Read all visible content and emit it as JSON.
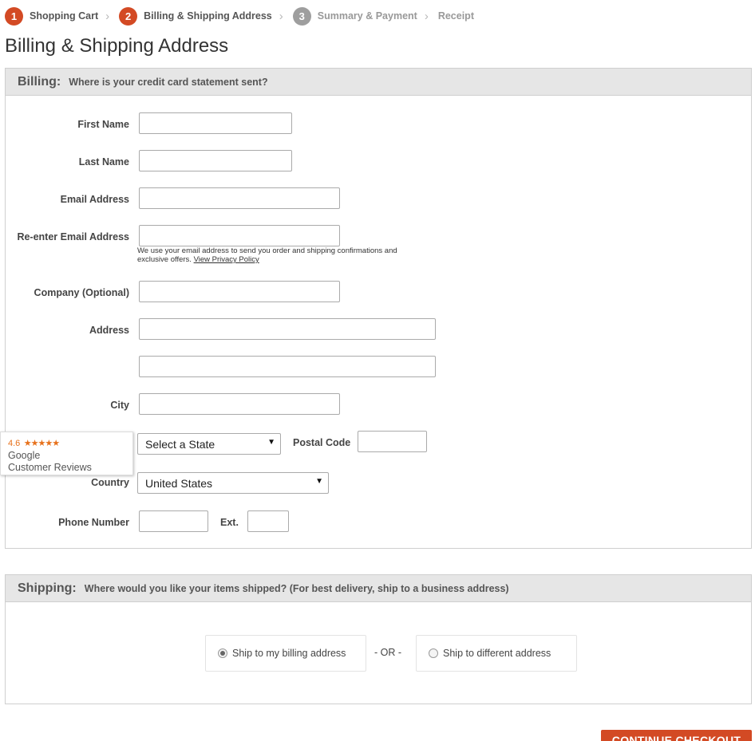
{
  "steps": [
    {
      "num": "1",
      "label": "Shopping Cart"
    },
    {
      "num": "2",
      "label": "Billing & Shipping Address"
    },
    {
      "num": "3",
      "label": "Summary & Payment"
    },
    {
      "label": "Receipt"
    }
  ],
  "page_title": "Billing & Shipping Address",
  "billing": {
    "title": "Billing:",
    "subtitle": "Where is your credit card statement sent?",
    "labels": {
      "first_name": "First Name",
      "last_name": "Last Name",
      "email": "Email Address",
      "email_confirm": "Re-enter Email Address",
      "company": "Company (Optional)",
      "address": "Address",
      "city": "City",
      "postal_code": "Postal Code",
      "country": "Country",
      "phone": "Phone Number",
      "ext": "Ext."
    },
    "email_note": "We use your email address to send you order and shipping confirmations and exclusive offers.",
    "privacy_link": "View Privacy Policy",
    "state_select": "Select a State",
    "country_select": "United States"
  },
  "reviews_badge": {
    "rating": "4.6",
    "stars": "★★★★★",
    "line1": "Google",
    "line2": "Customer Reviews"
  },
  "shipping": {
    "title": "Shipping:",
    "subtitle": "Where would you like your items shipped? (For best delivery, ship to a business address)",
    "option_billing": "Ship to my billing address",
    "or": "- OR -",
    "option_different": "Ship to different address"
  },
  "continue_button": "CONTINUE CHECKOUT",
  "colors": {
    "accent": "#d34a24",
    "step_inactive": "#9e9e9e",
    "panel_header": "#e6e6e6"
  }
}
